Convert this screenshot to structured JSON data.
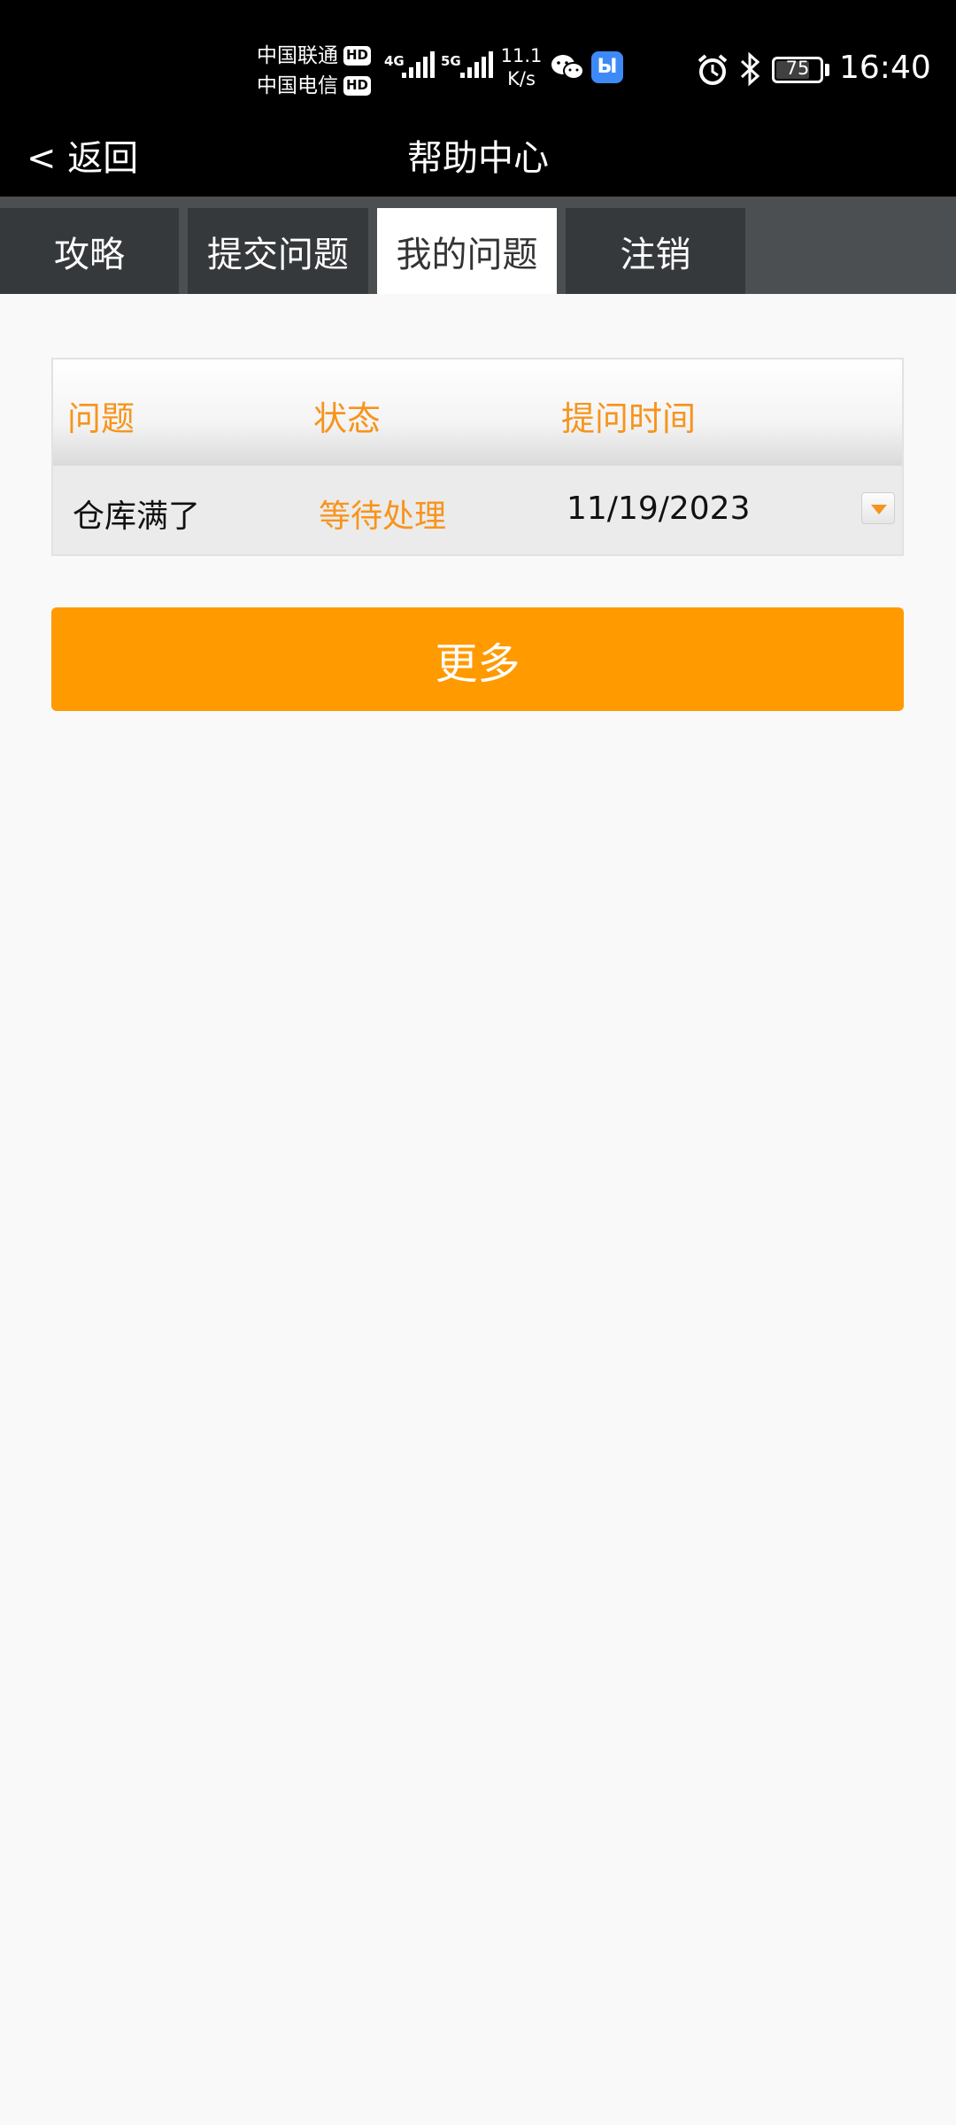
{
  "status_bar": {
    "carrier_1": "中国联通",
    "carrier_2": "中国电信",
    "hd_badge": "HD",
    "network_1": "4G",
    "network_2": "5G",
    "speed_value": "11.1",
    "speed_unit": "K/s",
    "battery": "75",
    "time": "16:40",
    "icons": [
      "signal-icon",
      "wechat-icon",
      "app-icon",
      "alarm-icon",
      "bluetooth-icon",
      "battery-icon"
    ]
  },
  "header": {
    "back_label": "< 返回",
    "title": "帮助中心"
  },
  "tabs": [
    {
      "label": "攻略",
      "active": false
    },
    {
      "label": "提交问题",
      "active": false
    },
    {
      "label": "我的问题",
      "active": true
    },
    {
      "label": "注销",
      "active": false
    }
  ],
  "table": {
    "columns": [
      "问题",
      "状态",
      "提问时间"
    ],
    "rows": [
      {
        "question": "仓库满了",
        "status": "等待处理",
        "time": "11/19/2023"
      }
    ]
  },
  "more_button": "更多",
  "colors": {
    "accent": "#ff9a00",
    "status_text": "#f7941d",
    "header_bg": "#000000",
    "tabbar_bg": "#4c4f52"
  }
}
